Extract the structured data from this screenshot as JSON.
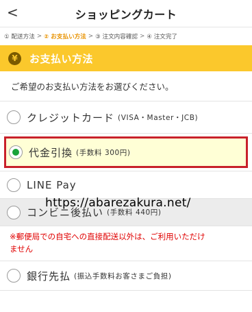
{
  "header": {
    "back_glyph": "<",
    "title": "ショッピングカート"
  },
  "steps": [
    {
      "label": "① 配送方法",
      "active": false
    },
    {
      "label": "② お支払い方法",
      "active": true
    },
    {
      "label": "③ 注文内容確認",
      "active": false
    },
    {
      "label": "④ 注文完了",
      "active": false
    }
  ],
  "steps_separator": ">",
  "section": {
    "icon_glyph": "¥",
    "title": "お支払い方法"
  },
  "instruction": "ご希望のお支払い方法をお選びください。",
  "options": {
    "credit": {
      "label": "クレジットカード",
      "sub": "(VISA・Master・JCB)",
      "selected": false
    },
    "cod": {
      "label": "代金引換",
      "sub": "(手数料 300円)",
      "selected": true
    },
    "line": {
      "label": "LINE Pay",
      "sub": "",
      "selected": false
    },
    "conv": {
      "label": "コンビニ後払い",
      "sub": "(手数料 440円)",
      "selected": false
    },
    "bank": {
      "label": "銀行先払",
      "sub": "(振込手数料お客さまご負担)",
      "selected": false
    }
  },
  "warning": {
    "line1": "※郵便局での自宅への直接配送以外は、ご利用いただけ",
    "line2": "ません"
  },
  "watermark": "https://abarezakura.net/",
  "colors": {
    "accent": "#fbc82c",
    "highlight_border": "#c8202a",
    "highlight_bg": "#ffffd6",
    "radio_selected": "#1aa33a",
    "warning": "#e00000"
  }
}
